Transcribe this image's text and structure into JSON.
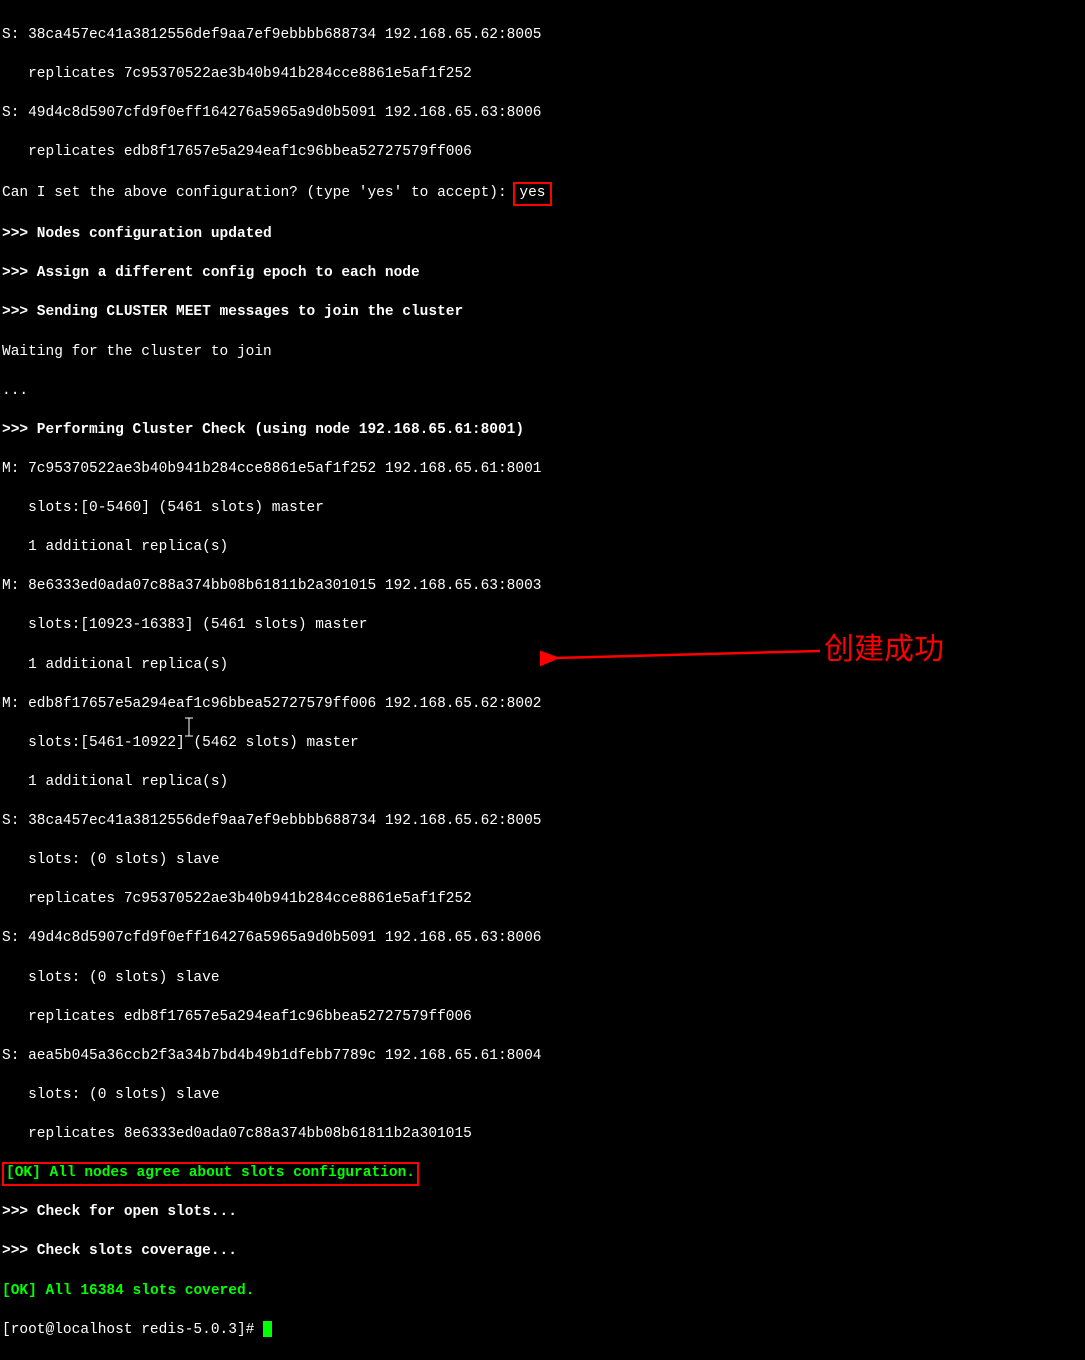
{
  "lines": {
    "l1": "S: 38ca457ec41a3812556def9aa7ef9ebbbb688734 192.168.65.62:8005",
    "l2": "   replicates 7c95370522ae3b40b941b284cce8861e5af1f252",
    "l3": "S: 49d4c8d5907cfd9f0eff164276a5965a9d0b5091 192.168.65.63:8006",
    "l4": "   replicates edb8f17657e5a294eaf1c96bbea52727579ff006",
    "l5a": "Can I set the above configuration? (type 'yes' to accept): ",
    "l5b": "yes",
    "l6": ">>> Nodes configuration updated",
    "l7": ">>> Assign a different config epoch to each node",
    "l8": ">>> Sending CLUSTER MEET messages to join the cluster",
    "l9": "Waiting for the cluster to join",
    "l10": "...",
    "l11": ">>> Performing Cluster Check (using node 192.168.65.61:8001)",
    "l12": "M: 7c95370522ae3b40b941b284cce8861e5af1f252 192.168.65.61:8001",
    "l13": "   slots:[0-5460] (5461 slots) master",
    "l14": "   1 additional replica(s)",
    "l15": "M: 8e6333ed0ada07c88a374bb08b61811b2a301015 192.168.65.63:8003",
    "l16": "   slots:[10923-16383] (5461 slots) master",
    "l17": "   1 additional replica(s)",
    "l18": "M: edb8f17657e5a294eaf1c96bbea52727579ff006 192.168.65.62:8002",
    "l19": "   slots:[5461-10922] (5462 slots) master",
    "l20": "   1 additional replica(s)",
    "l21": "S: 38ca457ec41a3812556def9aa7ef9ebbbb688734 192.168.65.62:8005",
    "l22": "   slots: (0 slots) slave",
    "l23": "   replicates 7c95370522ae3b40b941b284cce8861e5af1f252",
    "l24": "S: 49d4c8d5907cfd9f0eff164276a5965a9d0b5091 192.168.65.63:8006",
    "l25": "   slots: (0 slots) slave",
    "l26": "   replicates edb8f17657e5a294eaf1c96bbea52727579ff006",
    "l27": "S: aea5b045a36ccb2f3a34b7bd4b49b1dfebb7789c 192.168.65.61:8004",
    "l28": "   slots: (0 slots) slave",
    "l29": "   replicates 8e6333ed0ada07c88a374bb08b61811b2a301015",
    "l30": "[OK] All nodes agree about slots configuration.",
    "l31": ">>> Check for open slots...",
    "l32": ">>> Check slots coverage...",
    "l33a": "[OK] All 16384 sl",
    "l33b": "ots covered.",
    "l34": "[root@localhost redis-5.0.3]# "
  },
  "annotation": "创建成功"
}
